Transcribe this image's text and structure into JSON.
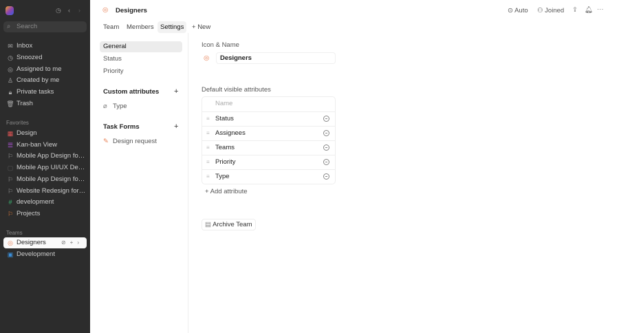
{
  "sidebar": {
    "search_placeholder": "Search",
    "nav": [
      {
        "label": "Inbox",
        "icon": "inbox-icon",
        "g": "✉"
      },
      {
        "label": "Snoozed",
        "icon": "clock-icon",
        "g": "◷"
      },
      {
        "label": "Assigned to me",
        "icon": "target-icon",
        "g": "◎"
      },
      {
        "label": "Created by me",
        "icon": "user-icon",
        "g": "♙"
      },
      {
        "label": "Private tasks",
        "icon": "lock-icon",
        "g": "🔒︎"
      },
      {
        "label": "Trash",
        "icon": "trash-icon",
        "g": "🗑︎"
      }
    ],
    "favorites_label": "Favorites",
    "favorites": [
      {
        "label": "Design",
        "g": "▦",
        "c": "#e05555"
      },
      {
        "label": "Kan-ban View",
        "g": "☰",
        "c": "#b455e0"
      },
      {
        "label": "Mobile App Design for ...",
        "g": "⚐",
        "c": "#999"
      },
      {
        "label": "Mobile App UI/UX Desi...",
        "g": "▢",
        "c": "#555"
      },
      {
        "label": "Mobile App Design for ...",
        "g": "⚐",
        "c": "#999"
      },
      {
        "label": "Website Redesign for a...",
        "g": "⚐",
        "c": "#999"
      },
      {
        "label": "development",
        "g": "#",
        "c": "#3cb371"
      },
      {
        "label": "Projects",
        "g": "⚐",
        "c": "#e07b39"
      }
    ],
    "teams_label": "Teams",
    "teams": [
      {
        "label": "Designers",
        "g": "◎",
        "c": "#e8845a"
      },
      {
        "label": "Development",
        "g": "▣",
        "c": "#3b8fd9"
      }
    ]
  },
  "header": {
    "title": "Designers",
    "auto": "Auto",
    "joined": "Joined"
  },
  "tabs": [
    "Team",
    "Members",
    "Settings",
    "New"
  ],
  "settings_nav": {
    "items": [
      "General",
      "Status",
      "Priority"
    ],
    "custom_attributes": "Custom attributes",
    "custom_items": [
      "Type"
    ],
    "task_forms": "Task Forms",
    "form_items": [
      "Design request"
    ]
  },
  "general": {
    "icon_name_label": "Icon & Name",
    "team_name": "Designers",
    "default_attrs_label": "Default visible attributes",
    "column_header": "Name",
    "attributes": [
      "Status",
      "Assignees",
      "Teams",
      "Priority",
      "Type"
    ],
    "add_attribute": "Add attribute",
    "archive": "Archive Team"
  }
}
